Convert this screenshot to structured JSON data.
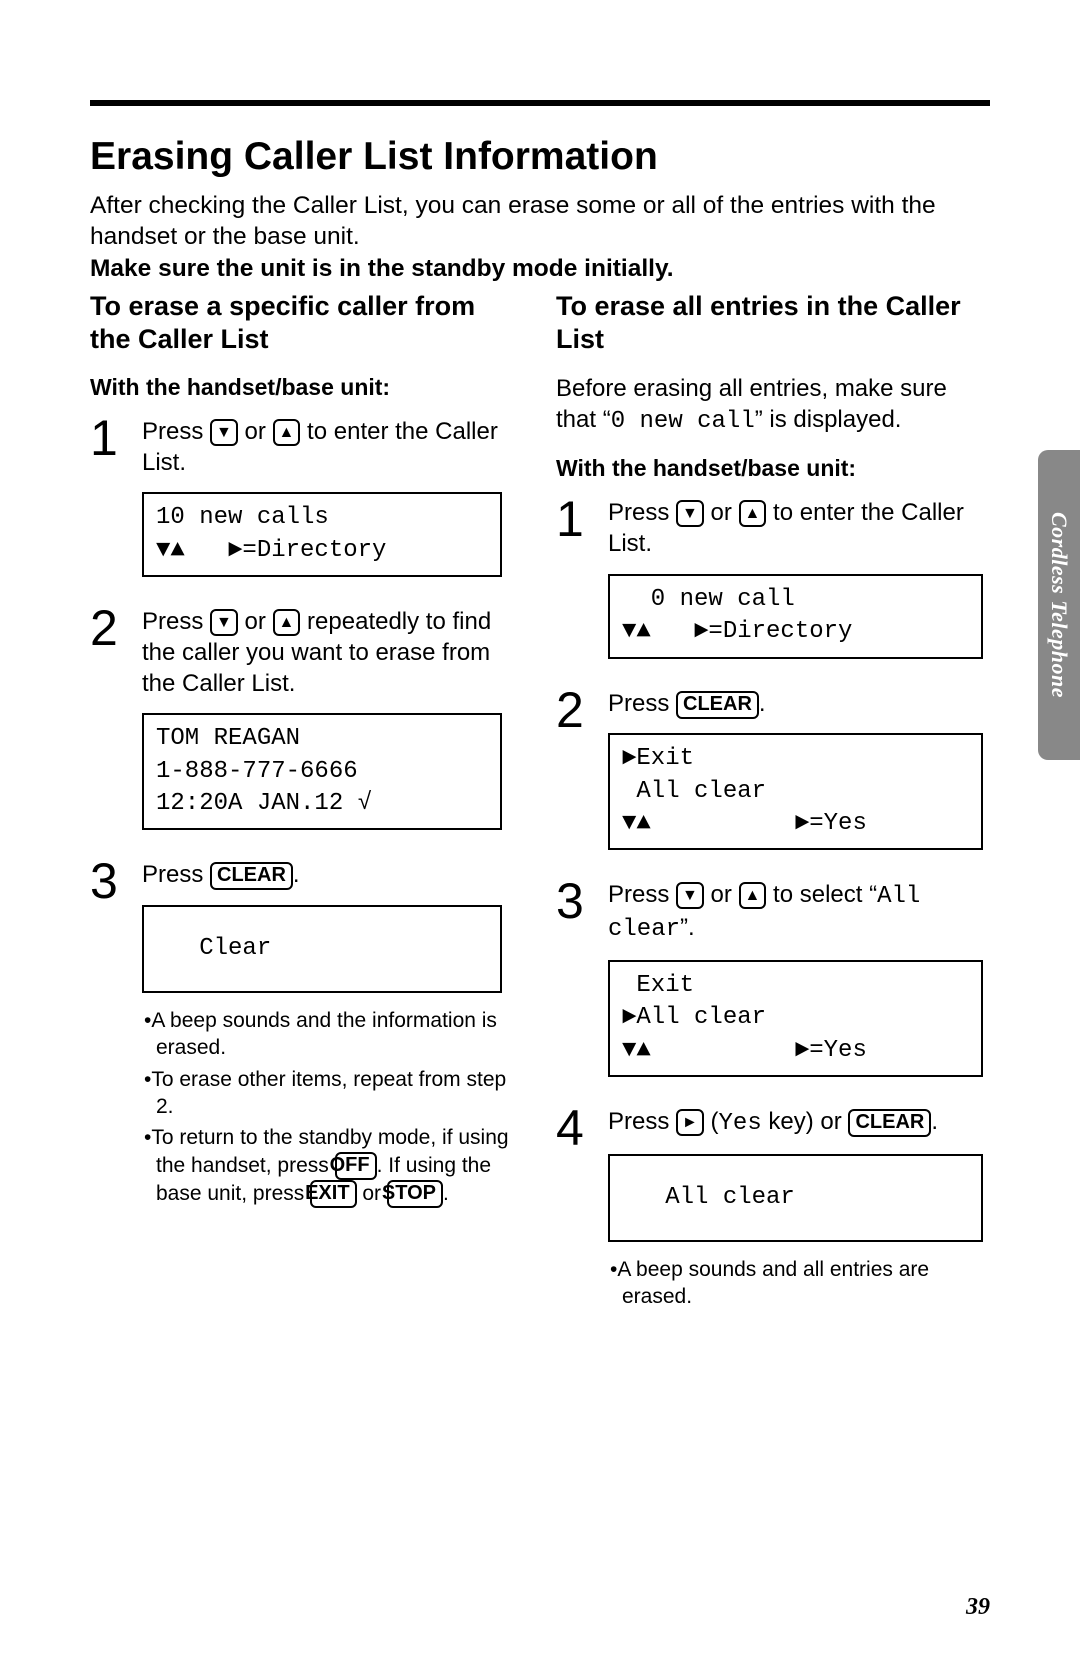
{
  "page_title": "Erasing Caller List Information",
  "intro_line1": "After checking the Caller List, you can erase some or all of the entries with the handset or the base unit.",
  "intro_bold": "Make sure the unit is in the standby mode initially.",
  "side_tab": "Cordless Telephone",
  "page_number": "39",
  "keys": {
    "down": "▼",
    "up": "▲",
    "right": "►",
    "clear": "CLEAR",
    "off": "OFF",
    "exit": "EXIT",
    "stop": "STOP"
  },
  "left": {
    "heading": "To erase a specific caller from the Caller List",
    "unit_label": "With the handset/base unit:",
    "step1_a": "Press ",
    "step1_b": " or ",
    "step1_c": " to enter the Caller List.",
    "lcd1_line1": "10 new calls",
    "lcd1_line2": "▼▲   ►=Directory",
    "step2_a": "Press ",
    "step2_b": " or ",
    "step2_c": " repeatedly to find the caller you want to erase from the Caller List.",
    "lcd2_line1": "TOM REAGAN",
    "lcd2_line2": "1-888-777-6666",
    "lcd2_line3": "12:20A JAN.12 √",
    "step3_a": "Press ",
    "step3_b": ".",
    "lcd3_line1": "   Clear",
    "bullet1": "A beep sounds and the information is erased.",
    "bullet2": "To erase other items, repeat from step 2.",
    "bullet3_a": "To return to the standby mode, if using the handset, press ",
    "bullet3_b": ". If using the base unit, press ",
    "bullet3_c": " or ",
    "bullet3_d": "."
  },
  "right": {
    "heading": "To erase all entries in the Caller List",
    "before_a": "Before erasing all entries, make sure that “",
    "before_mono": "0 new call",
    "before_b": "” is displayed.",
    "unit_label": "With the handset/base unit:",
    "step1_a": "Press ",
    "step1_b": " or ",
    "step1_c": " to enter the Caller List.",
    "lcd1_line1": "  0 new call",
    "lcd1_line2": "▼▲   ►=Directory",
    "step2_a": "Press ",
    "step2_b": ".",
    "lcd2_line1": "►Exit",
    "lcd2_line2": " All clear",
    "lcd2_line3": "▼▲          ►=Yes",
    "step3_a": "Press ",
    "step3_b": " or ",
    "step3_c": " to select “",
    "step3_mono": "All clear",
    "step3_d": "”.",
    "lcd3_line1": " Exit",
    "lcd3_line2": "►All clear",
    "lcd3_line3": "▼▲          ►=Yes",
    "step4_a": "Press ",
    "step4_b": " (",
    "step4_mono": "Yes",
    "step4_c": " key) or ",
    "step4_d": ".",
    "lcd4_line1": "   All clear",
    "bullet1": "A beep sounds and all entries are erased."
  }
}
